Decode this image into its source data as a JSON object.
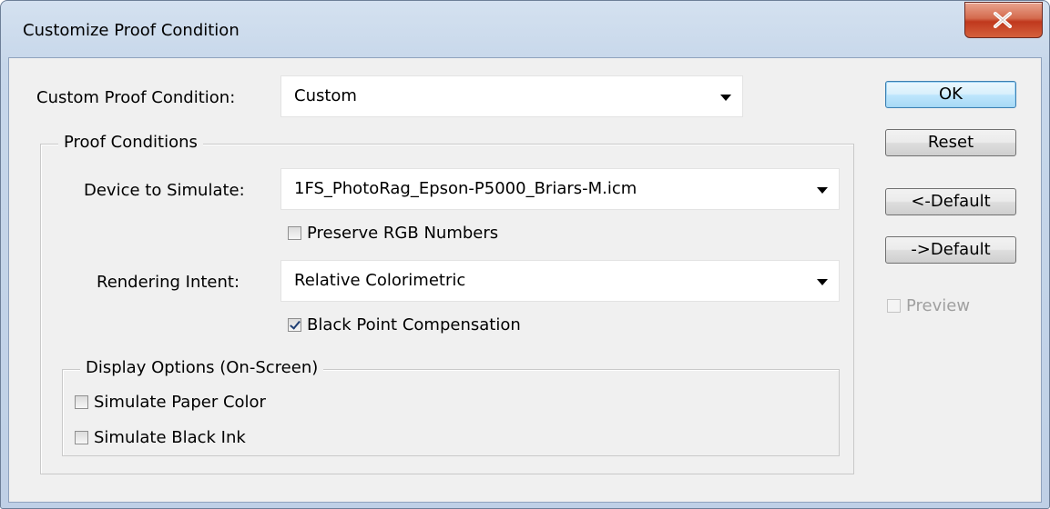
{
  "window": {
    "title": "Customize Proof Condition"
  },
  "form": {
    "custom_condition": {
      "label": "Custom Proof Condition:",
      "value": "Custom"
    },
    "proof_conditions": {
      "legend": "Proof Conditions",
      "device": {
        "label": "Device to Simulate:",
        "value": "1FS_PhotoRag_Epson-P5000_Briars-M.icm"
      },
      "preserve_rgb": {
        "label": "Preserve RGB Numbers",
        "checked": false
      },
      "intent": {
        "label": "Rendering Intent:",
        "value": "Relative Colorimetric"
      },
      "black_point": {
        "label": "Black Point Compensation",
        "checked": true
      },
      "display_options": {
        "legend": "Display Options (On-Screen)",
        "paper_color": {
          "label": "Simulate Paper Color",
          "checked": false
        },
        "black_ink": {
          "label": "Simulate Black Ink",
          "checked": false
        }
      }
    }
  },
  "buttons": {
    "ok": "OK",
    "reset": "Reset",
    "load_default": "<-Default",
    "save_default": "->Default",
    "preview": {
      "label": "Preview",
      "checked": false,
      "enabled": false
    }
  }
}
